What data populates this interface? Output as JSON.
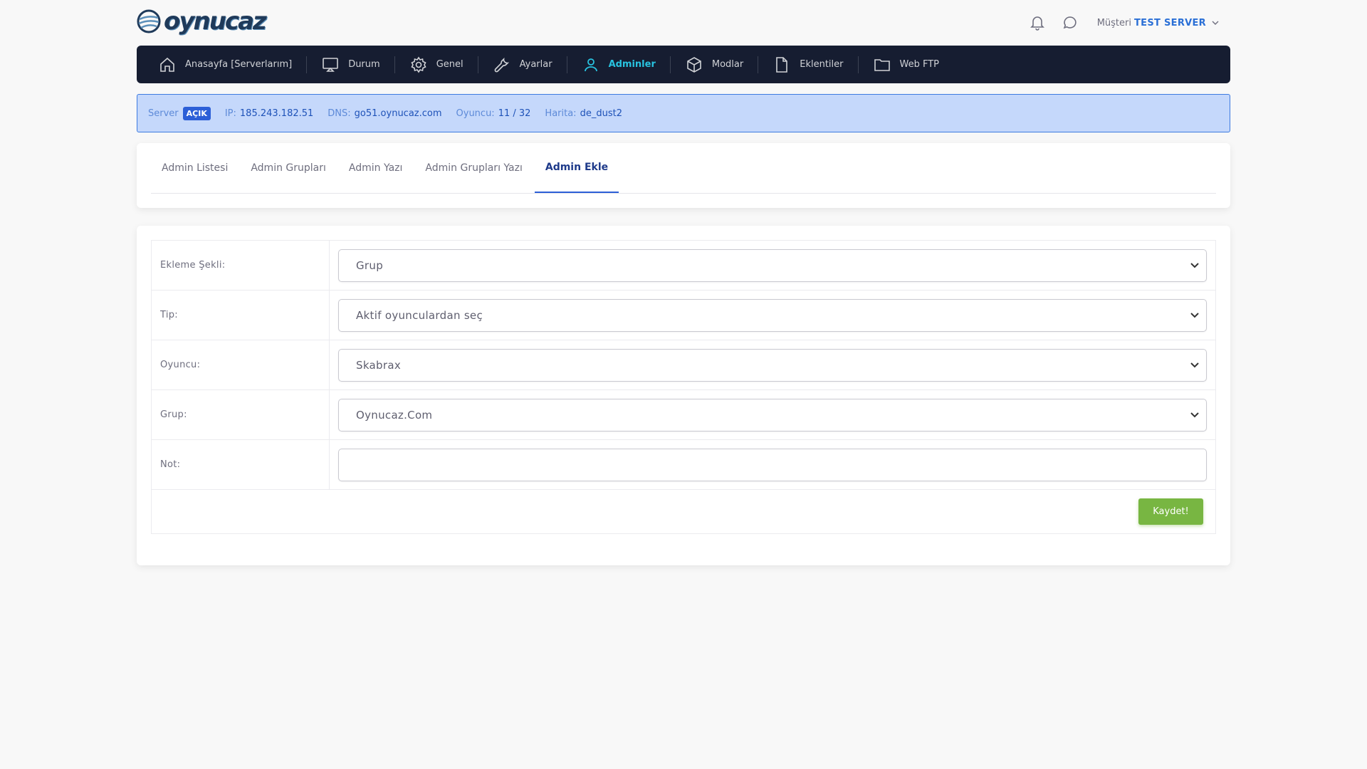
{
  "brand": {
    "logo_text": "oynucaz"
  },
  "header": {
    "user_prefix": "Müşteri",
    "user_name": "TEST SERVER"
  },
  "nav": {
    "items": [
      {
        "label": "Anasayfa [Serverlarım]",
        "icon": "home-icon"
      },
      {
        "label": "Durum",
        "icon": "monitor-icon"
      },
      {
        "label": "Genel",
        "icon": "gear-icon"
      },
      {
        "label": "Ayarlar",
        "icon": "wrench-icon"
      },
      {
        "label": "Adminler",
        "icon": "user-icon"
      },
      {
        "label": "Modlar",
        "icon": "box-icon"
      },
      {
        "label": "Eklentiler",
        "icon": "file-icon"
      },
      {
        "label": "Web FTP",
        "icon": "folder-icon"
      }
    ],
    "active_index": 4,
    "active_color": "#28c3e0"
  },
  "status": {
    "server_label": "Server",
    "server_state": "AÇIK",
    "ip_label": "IP:",
    "ip": "185.243.182.51",
    "dns_label": "DNS:",
    "dns": "go51.oynucaz.com",
    "players_label": "Oyuncu:",
    "players": "11 / 32",
    "map_label": "Harita:",
    "map": "de_dust2"
  },
  "tabs": [
    {
      "label": "Admin Listesi"
    },
    {
      "label": "Admin Grupları"
    },
    {
      "label": "Admin Yazı"
    },
    {
      "label": "Admin Grupları Yazı"
    },
    {
      "label": "Admin Ekle"
    }
  ],
  "form": {
    "rows": [
      {
        "label": "Ekleme Şekli:",
        "value": "Grup"
      },
      {
        "label": "Tip:",
        "value": "Aktif oyunculardan seç"
      },
      {
        "label": "Oyuncu:",
        "value": "Skabrax"
      },
      {
        "label": "Grup:",
        "value": "Oynucaz.Com"
      }
    ],
    "note_label": "Not:",
    "note_value": "",
    "submit_label": "Kaydet!"
  },
  "colors": {
    "nav_bg": "#161d31",
    "status_bg": "#c5d8fb",
    "accent_blue": "#2c5fd7",
    "save_green": "#78b642"
  }
}
